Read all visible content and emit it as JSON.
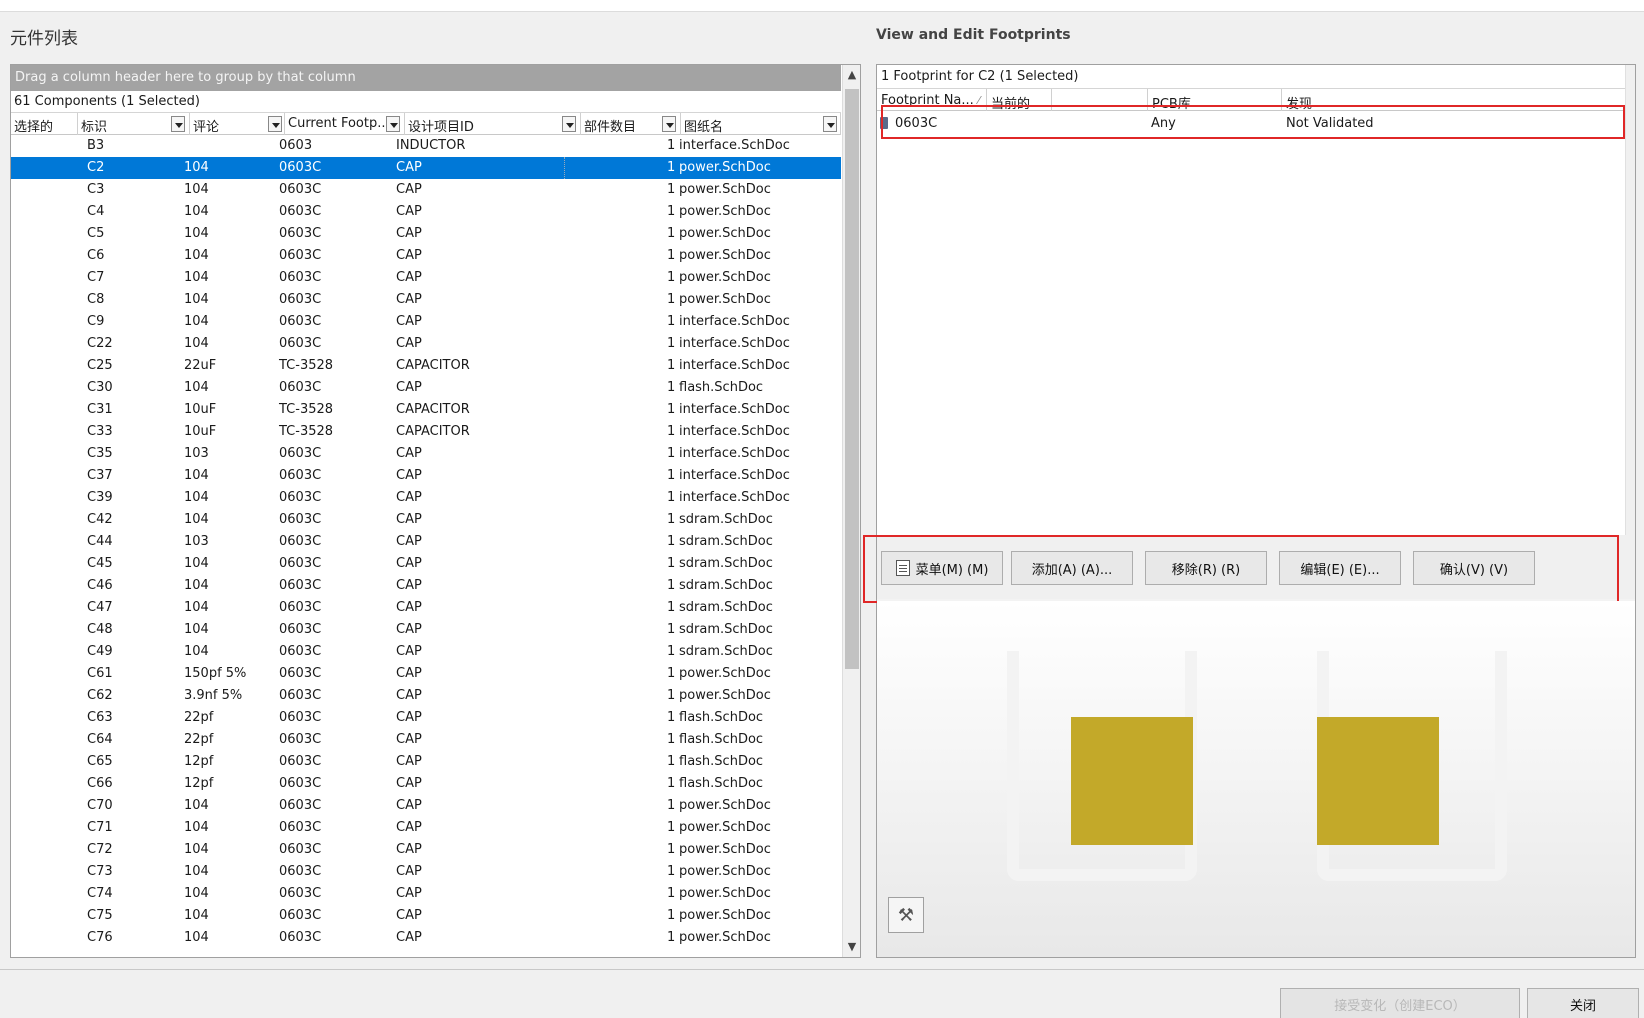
{
  "left_panel": {
    "title": "元件列表",
    "group_hint": "Drag a column header here to group by that column",
    "count_text": "61 Components (1 Selected)",
    "columns": [
      "选择的",
      "标识",
      "评论",
      "Current Footp...",
      "设计项目ID",
      "部件数目",
      "图纸名"
    ],
    "rows": [
      [
        "",
        "B3",
        "",
        "0603",
        "INDUCTOR",
        "1",
        "interface.SchDoc"
      ],
      [
        "",
        "C2",
        "104",
        "0603C",
        "CAP",
        "1",
        "power.SchDoc"
      ],
      [
        "",
        "C3",
        "104",
        "0603C",
        "CAP",
        "1",
        "power.SchDoc"
      ],
      [
        "",
        "C4",
        "104",
        "0603C",
        "CAP",
        "1",
        "power.SchDoc"
      ],
      [
        "",
        "C5",
        "104",
        "0603C",
        "CAP",
        "1",
        "power.SchDoc"
      ],
      [
        "",
        "C6",
        "104",
        "0603C",
        "CAP",
        "1",
        "power.SchDoc"
      ],
      [
        "",
        "C7",
        "104",
        "0603C",
        "CAP",
        "1",
        "power.SchDoc"
      ],
      [
        "",
        "C8",
        "104",
        "0603C",
        "CAP",
        "1",
        "power.SchDoc"
      ],
      [
        "",
        "C9",
        "104",
        "0603C",
        "CAP",
        "1",
        "interface.SchDoc"
      ],
      [
        "",
        "C22",
        "104",
        "0603C",
        "CAP",
        "1",
        "interface.SchDoc"
      ],
      [
        "",
        "C25",
        "22uF",
        "TC-3528",
        "CAPACITOR",
        "1",
        "interface.SchDoc"
      ],
      [
        "",
        "C30",
        "104",
        "0603C",
        "CAP",
        "1",
        "flash.SchDoc"
      ],
      [
        "",
        "C31",
        "10uF",
        "TC-3528",
        "CAPACITOR",
        "1",
        "interface.SchDoc"
      ],
      [
        "",
        "C33",
        "10uF",
        "TC-3528",
        "CAPACITOR",
        "1",
        "interface.SchDoc"
      ],
      [
        "",
        "C35",
        "103",
        "0603C",
        "CAP",
        "1",
        "interface.SchDoc"
      ],
      [
        "",
        "C37",
        "104",
        "0603C",
        "CAP",
        "1",
        "interface.SchDoc"
      ],
      [
        "",
        "C39",
        "104",
        "0603C",
        "CAP",
        "1",
        "interface.SchDoc"
      ],
      [
        "",
        "C42",
        "104",
        "0603C",
        "CAP",
        "1",
        "sdram.SchDoc"
      ],
      [
        "",
        "C44",
        "103",
        "0603C",
        "CAP",
        "1",
        "sdram.SchDoc"
      ],
      [
        "",
        "C45",
        "104",
        "0603C",
        "CAP",
        "1",
        "sdram.SchDoc"
      ],
      [
        "",
        "C46",
        "104",
        "0603C",
        "CAP",
        "1",
        "sdram.SchDoc"
      ],
      [
        "",
        "C47",
        "104",
        "0603C",
        "CAP",
        "1",
        "sdram.SchDoc"
      ],
      [
        "",
        "C48",
        "104",
        "0603C",
        "CAP",
        "1",
        "sdram.SchDoc"
      ],
      [
        "",
        "C49",
        "104",
        "0603C",
        "CAP",
        "1",
        "sdram.SchDoc"
      ],
      [
        "",
        "C61",
        "150pf 5%",
        "0603C",
        "CAP",
        "1",
        "power.SchDoc"
      ],
      [
        "",
        "C62",
        "3.9nf 5%",
        "0603C",
        "CAP",
        "1",
        "power.SchDoc"
      ],
      [
        "",
        "C63",
        "22pf",
        "0603C",
        "CAP",
        "1",
        "flash.SchDoc"
      ],
      [
        "",
        "C64",
        "22pf",
        "0603C",
        "CAP",
        "1",
        "flash.SchDoc"
      ],
      [
        "",
        "C65",
        "12pf",
        "0603C",
        "CAP",
        "1",
        "flash.SchDoc"
      ],
      [
        "",
        "C66",
        "12pf",
        "0603C",
        "CAP",
        "1",
        "flash.SchDoc"
      ],
      [
        "",
        "C70",
        "104",
        "0603C",
        "CAP",
        "1",
        "power.SchDoc"
      ],
      [
        "",
        "C71",
        "104",
        "0603C",
        "CAP",
        "1",
        "power.SchDoc"
      ],
      [
        "",
        "C72",
        "104",
        "0603C",
        "CAP",
        "1",
        "power.SchDoc"
      ],
      [
        "",
        "C73",
        "104",
        "0603C",
        "CAP",
        "1",
        "power.SchDoc"
      ],
      [
        "",
        "C74",
        "104",
        "0603C",
        "CAP",
        "1",
        "power.SchDoc"
      ],
      [
        "",
        "C75",
        "104",
        "0603C",
        "CAP",
        "1",
        "power.SchDoc"
      ],
      [
        "",
        "C76",
        "104",
        "0603C",
        "CAP",
        "1",
        "power.SchDoc"
      ]
    ],
    "selected_row": 1
  },
  "right_panel": {
    "title": "View and Edit Footprints",
    "count_text": "1 Footprint for C2 (1 Selected)",
    "columns": [
      "Footprint Na...",
      "当前的",
      "PCB库",
      "发现"
    ],
    "sort_indicator": "⁄",
    "row": {
      "name": "0603C",
      "current": "",
      "pcb_lib": "Any",
      "found": "Not Validated"
    },
    "buttons": {
      "menu": "菜单(M) (M)",
      "add": "添加(A) (A)...",
      "remove": "移除(R) (R)",
      "edit": "编辑(E) (E)...",
      "validate": "确认(V) (V)"
    },
    "pad_color": "#c3a929"
  },
  "bottom": {
    "accept": "接受变化（创建ECO）",
    "close": "关闭"
  },
  "colors": {
    "selection": "#0078d7",
    "highlight_box": "#e02727"
  }
}
